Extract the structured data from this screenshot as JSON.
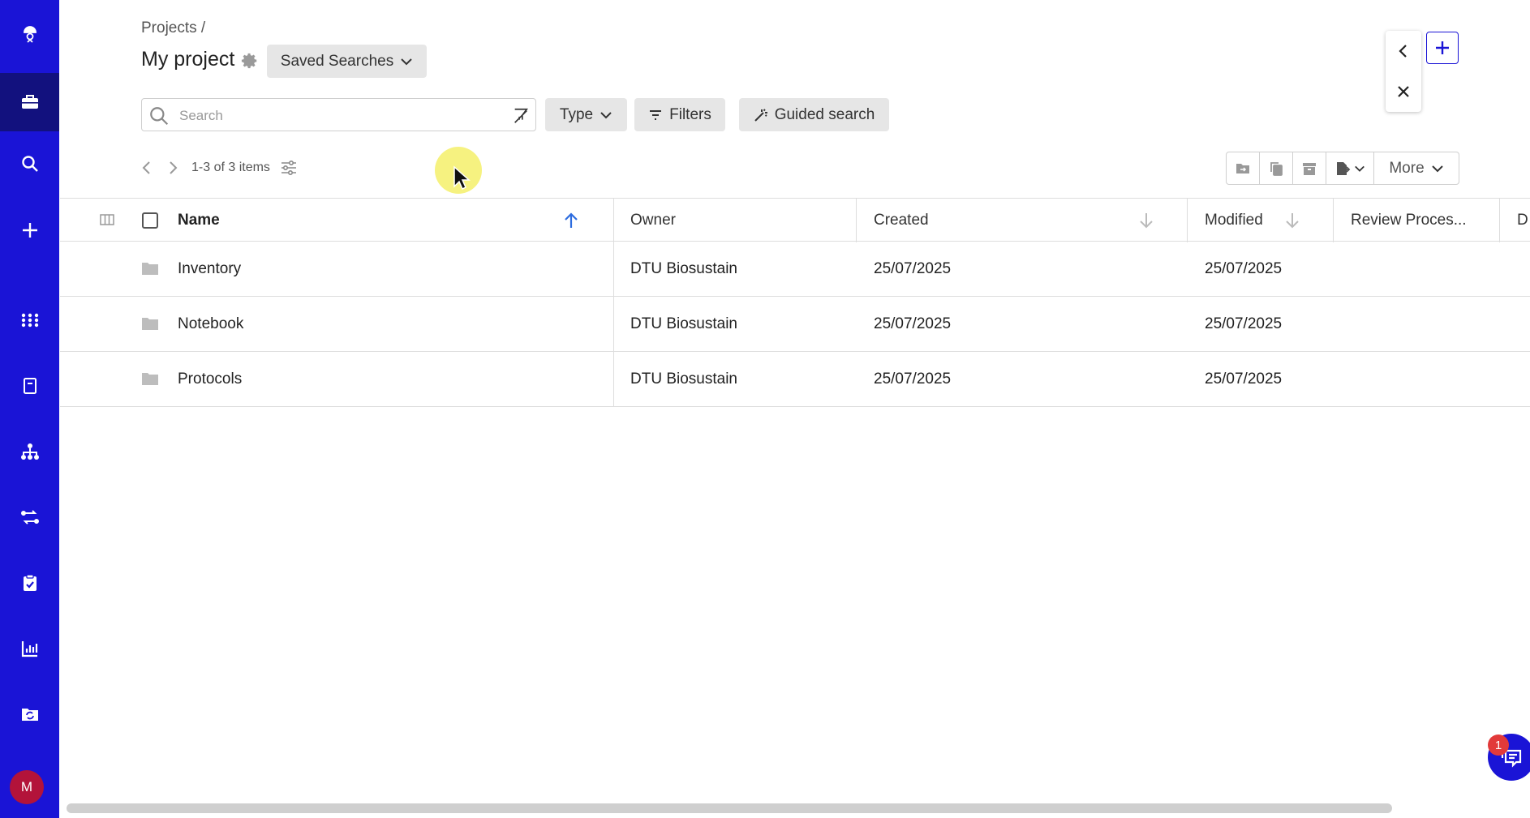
{
  "sidebar": {
    "items": [
      {
        "icon": "scientist-icon"
      },
      {
        "icon": "briefcase-icon",
        "active": true
      },
      {
        "icon": "search-icon"
      },
      {
        "icon": "plus-icon"
      },
      {
        "icon": "apps-grid-icon"
      },
      {
        "icon": "notebook-icon"
      },
      {
        "icon": "hierarchy-icon"
      },
      {
        "icon": "workflow-icon"
      },
      {
        "icon": "clipboard-check-icon"
      },
      {
        "icon": "bar-chart-icon"
      },
      {
        "icon": "folder-sync-icon"
      }
    ],
    "avatar_initial": "M",
    "avatar_color": "#b3133a",
    "bg_color": "#1a14d6",
    "active_color": "#12117e"
  },
  "header": {
    "breadcrumb": "Projects /",
    "title": "My project",
    "saved_searches_label": "Saved Searches"
  },
  "toolbar": {
    "search_placeholder": "Search",
    "type_label": "Type",
    "filters_label": "Filters",
    "guided_search_label": "Guided search"
  },
  "pager": {
    "label": "1-3 of 3 items"
  },
  "actions": {
    "more_label": "More"
  },
  "table": {
    "columns": [
      {
        "label": "Name",
        "sort": "asc"
      },
      {
        "label": "Owner"
      },
      {
        "label": "Created",
        "sort": "desc-inactive"
      },
      {
        "label": "Modified",
        "sort": "desc-inactive"
      },
      {
        "label": "Review Proces..."
      },
      {
        "label": "D"
      }
    ],
    "rows": [
      {
        "name": "Inventory",
        "owner": "DTU Biosustain",
        "created": "25/07/2025",
        "modified": "25/07/2025"
      },
      {
        "name": "Notebook",
        "owner": "DTU Biosustain",
        "created": "25/07/2025",
        "modified": "25/07/2025"
      },
      {
        "name": "Protocols",
        "owner": "DTU Biosustain",
        "created": "25/07/2025",
        "modified": "25/07/2025"
      }
    ]
  },
  "chat": {
    "badge_count": "1"
  },
  "colors": {
    "accent": "#1a14d6",
    "sort_active": "#2d6cdf",
    "badge": "#e23a3a"
  }
}
